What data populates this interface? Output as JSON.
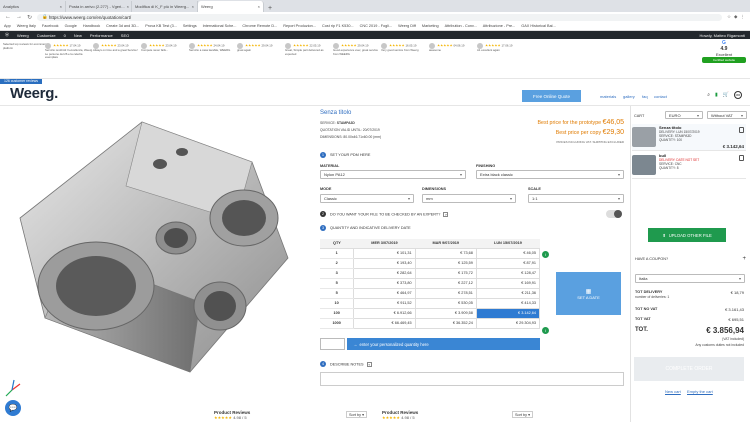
{
  "browser": {
    "tabs": [
      {
        "label": "Analytics"
      },
      {
        "label": "Posta in arrivo (2.277) - Vgeri..."
      },
      {
        "label": "Modifica di K_F più in Weerg..."
      },
      {
        "label": "Weerg"
      }
    ],
    "url": "https://www.weerg.com/en/quotation/cart/",
    "bookmarks": [
      "App",
      "Weerg Italy",
      "Facebook",
      "Google",
      "Handbook",
      "Create 3d and 3D...",
      "Prova KB Test (3...",
      "Settings",
      "International Sche...",
      "Chrome Remote D...",
      "Report Produzion...",
      "Cost rip F1 K530...",
      "CNC 2019 - Fogli...",
      "Weerg Diff",
      "Marketing",
      "Attribution - Conv...",
      "Attribuzione - Pre...",
      "GAX Historical Bal..."
    ]
  },
  "wp_admin": {
    "items": [
      "Weerg",
      "Customize",
      "0",
      "New",
      "Performance",
      "SEO"
    ],
    "greeting": "Howdy, Matteo Rigamonti"
  },
  "reviews_bar": {
    "first_text": "Selected top reviews for ecommerce platform",
    "items": [
      {
        "date": "17.04.19",
        "text": "Servizio rendimiti Il eccellenza, Weerg. Le persone del 26 e la celerita esemplare"
      },
      {
        "date": "23.04.19",
        "text": "Always on time and a great Service!"
      },
      {
        "date": "23.04.19",
        "text": "Compete never fails..."
      },
      {
        "date": "24.04.19",
        "text": "Servizio a casa lavabile, WEERG"
      },
      {
        "date": "29.04.19",
        "text": "great again"
      },
      {
        "date": "22.05.19",
        "text": "Great, Simple part delivered as expected"
      },
      {
        "date": "29.04.19",
        "text": "Good experience ever, great service from WEERG"
      },
      {
        "date": "16.05.19",
        "text": "Very good service from Weerg"
      },
      {
        "date": "04.06.19",
        "text": "awesome"
      },
      {
        "date": "17.06.19",
        "text": "A1 excellent again"
      }
    ],
    "google_rating": "4.9",
    "google_label": "Excellent",
    "certified": "Certified website",
    "review_count": "126 customer reviews"
  },
  "header": {
    "logo": "Weerg.",
    "quote_button": "Free Online Quote",
    "links": [
      "materials",
      "gallery",
      "faq",
      "contact"
    ]
  },
  "config": {
    "title": "Senza titolo",
    "service_label": "SERVICE:",
    "service_value": "STAMPA3D",
    "quotation_label": "QUOTATION VALID UNTIL:",
    "quotation_value": "20/07/2019",
    "dimensions_label": "DIMENSIONS:",
    "dimensions_value": "80.00x46.71x60.00 (mm)",
    "proto_label": "Best price for the prototype",
    "proto_price": "€46,05",
    "per_copy_label": "Best price per copy",
    "per_copy_price": "€29,30",
    "shipping_note": "PRICES INCLUDING VAT. SHIPPING EXCLUDED",
    "step1": "SET YOUR PDM HERE",
    "material_label": "MATERIAL",
    "material_value": "Nylon PA12",
    "finishing_label": "FINISHING",
    "finishing_value": "Extra black classic",
    "mode_label": "MODE",
    "mode_value": "Classic",
    "dimensions_sel_label": "DIMENSIONS",
    "dimensions_sel_value": "mm",
    "scale_label": "SCALE",
    "scale_value": "1:1",
    "step2": "DO YOU WANT YOUR FILE TO BE CHECKED BY AN EXPERT?",
    "step3": "QUANTITY AND INDICATIVE DELIVERY DATE",
    "table": {
      "headers": [
        "QTY",
        "MER 3/07/2019",
        "MAR 9/07/2019",
        "LUN 15/07/2019"
      ],
      "rows": [
        [
          "1",
          "€ 101,31",
          "€ 73,68",
          "€ 46,05"
        ],
        [
          "2",
          "€ 193,40",
          "€ 125,59",
          "€ 87,91"
        ],
        [
          "3",
          "€ 282,64",
          "€ 175,72",
          "€ 128,47"
        ],
        [
          "5",
          "€ 373,80",
          "€ 227,12",
          "€ 169,91"
        ],
        [
          "5",
          "€ 464,97",
          "€ 278,51",
          "€ 211,36"
        ],
        [
          "10",
          "€ 911,52",
          "€ 530,05",
          "€ 414,33"
        ],
        [
          "100",
          "€ 6.912,66",
          "€ 3.909,58",
          "€ 3.142,64"
        ],
        [
          "1000",
          "€ 66.469,45",
          "€ 36.352,24",
          "€ 29.304,93"
        ]
      ]
    },
    "got_date": "SET A DATE",
    "custom_qty": "enter your personalized quantity here",
    "step4": "DESCRIBE NOTES"
  },
  "cart": {
    "title": "CART",
    "currency": "EURO",
    "vat": "Without VAT",
    "items": [
      {
        "name": "Senza titolo",
        "line1": "DELIVERY: LUN 15/07/2019",
        "line2": "SERVICE: STAMPA3D",
        "line3": "QUANTITY: 100",
        "price": "€ 3.142,64"
      },
      {
        "name": "bull",
        "line1": "DELIVERY: DATE NOT SET",
        "line2": "SERVICE: CNC",
        "line3": "QUANTITY: 8",
        "price": ""
      }
    ],
    "upload": "UPLOAD OTHER FILE",
    "coupon_label": "HAVE A COUPON?",
    "country": "Italia",
    "tot_delivery_label": "TOT DELIVERY",
    "tot_delivery_value": "€ 18,79",
    "deliveries_note": "number of deliveries: 1",
    "tot_novat_label": "TOT NO VAT",
    "tot_novat_value": "€ 3.161,43",
    "tot_vat_label": "TOT VAT",
    "tot_vat_value": "€ 695,51",
    "tot_label": "TOT.",
    "tot_value": "€ 3.856,94",
    "vat_incl": "(VAT included)",
    "customs": "Any customs duties not included",
    "checkout": "COMPLETE ORDER",
    "new_cart": "New cart",
    "empty_cart": "Empty the cart"
  },
  "footer_reviews": [
    {
      "title": "Product Reviews",
      "score": "4.98 / 5",
      "sort": "Sort by"
    },
    {
      "title": "Product Reviews",
      "score": "4.98 / 5",
      "sort": "Sort by"
    }
  ],
  "colors": {
    "accent": "#2f7bd2",
    "green": "#1f9a4e",
    "price": "#e07b00",
    "wp": "#23282d"
  }
}
